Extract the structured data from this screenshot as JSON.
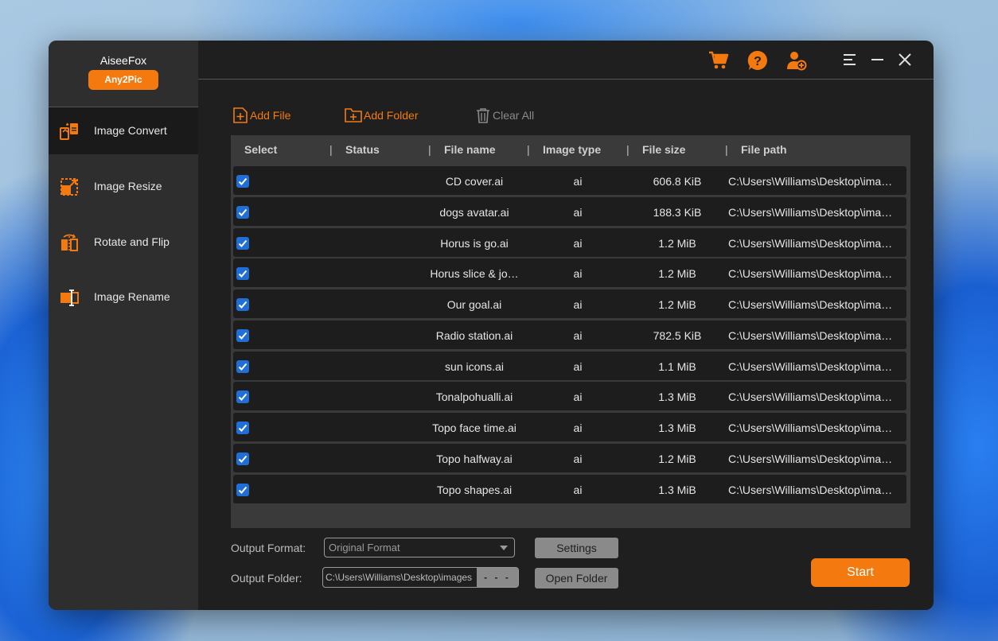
{
  "brand": {
    "name": "AiseeFox",
    "product": "Any2Pic"
  },
  "sidebar": {
    "items": [
      {
        "label": "Image Convert",
        "icon": "image-convert-icon",
        "active": true
      },
      {
        "label": "Image Resize",
        "icon": "image-resize-icon",
        "active": false
      },
      {
        "label": "Rotate and Flip",
        "icon": "rotate-flip-icon",
        "active": false
      },
      {
        "label": "Image Rename",
        "icon": "image-rename-icon",
        "active": false
      }
    ]
  },
  "topbar": {
    "icons": [
      "cart-icon",
      "help-icon",
      "user-add-icon",
      "menu-icon",
      "minimize-icon",
      "close-icon"
    ]
  },
  "toolbar": {
    "add_file": "Add File",
    "add_folder": "Add Folder",
    "clear_all": "Clear All"
  },
  "table": {
    "columns": [
      "Select",
      "Status",
      "File name",
      "Image type",
      "File size",
      "File path"
    ],
    "rows": [
      {
        "checked": true,
        "name": "CD cover.ai",
        "type": "ai",
        "size": "606.8 KiB",
        "path": "C:\\Users\\Williams\\Desktop\\ima…"
      },
      {
        "checked": true,
        "name": "dogs avatar.ai",
        "type": "ai",
        "size": "188.3 KiB",
        "path": "C:\\Users\\Williams\\Desktop\\ima…"
      },
      {
        "checked": true,
        "name": "Horus is go.ai",
        "type": "ai",
        "size": "1.2 MiB",
        "path": "C:\\Users\\Williams\\Desktop\\ima…"
      },
      {
        "checked": true,
        "name": "Horus slice & jo…",
        "type": "ai",
        "size": "1.2 MiB",
        "path": "C:\\Users\\Williams\\Desktop\\ima…"
      },
      {
        "checked": true,
        "name": "Our goal.ai",
        "type": "ai",
        "size": "1.2 MiB",
        "path": "C:\\Users\\Williams\\Desktop\\ima…"
      },
      {
        "checked": true,
        "name": "Radio station.ai",
        "type": "ai",
        "size": "782.5 KiB",
        "path": "C:\\Users\\Williams\\Desktop\\ima…"
      },
      {
        "checked": true,
        "name": "sun icons.ai",
        "type": "ai",
        "size": "1.1 MiB",
        "path": "C:\\Users\\Williams\\Desktop\\ima…"
      },
      {
        "checked": true,
        "name": "Tonalpohualli.ai",
        "type": "ai",
        "size": "1.3 MiB",
        "path": "C:\\Users\\Williams\\Desktop\\ima…"
      },
      {
        "checked": true,
        "name": "Topo face time.ai",
        "type": "ai",
        "size": "1.3 MiB",
        "path": "C:\\Users\\Williams\\Desktop\\ima…"
      },
      {
        "checked": true,
        "name": "Topo halfway.ai",
        "type": "ai",
        "size": "1.2 MiB",
        "path": "C:\\Users\\Williams\\Desktop\\ima…"
      },
      {
        "checked": true,
        "name": "Topo shapes.ai",
        "type": "ai",
        "size": "1.3 MiB",
        "path": "C:\\Users\\Williams\\Desktop\\ima…"
      }
    ]
  },
  "output": {
    "format_label": "Output Format:",
    "format_value": "Original Format",
    "settings_label": "Settings",
    "folder_label": "Output Folder:",
    "folder_value": "C:\\Users\\Williams\\Desktop\\images",
    "browse_label": "- - -",
    "open_folder_label": "Open Folder",
    "start_label": "Start"
  },
  "colors": {
    "accent": "#f47a10",
    "checkbox": "#1f6fd6",
    "window_bg": "#1f1f1f",
    "sidebar_bg": "#2e2e2e"
  }
}
